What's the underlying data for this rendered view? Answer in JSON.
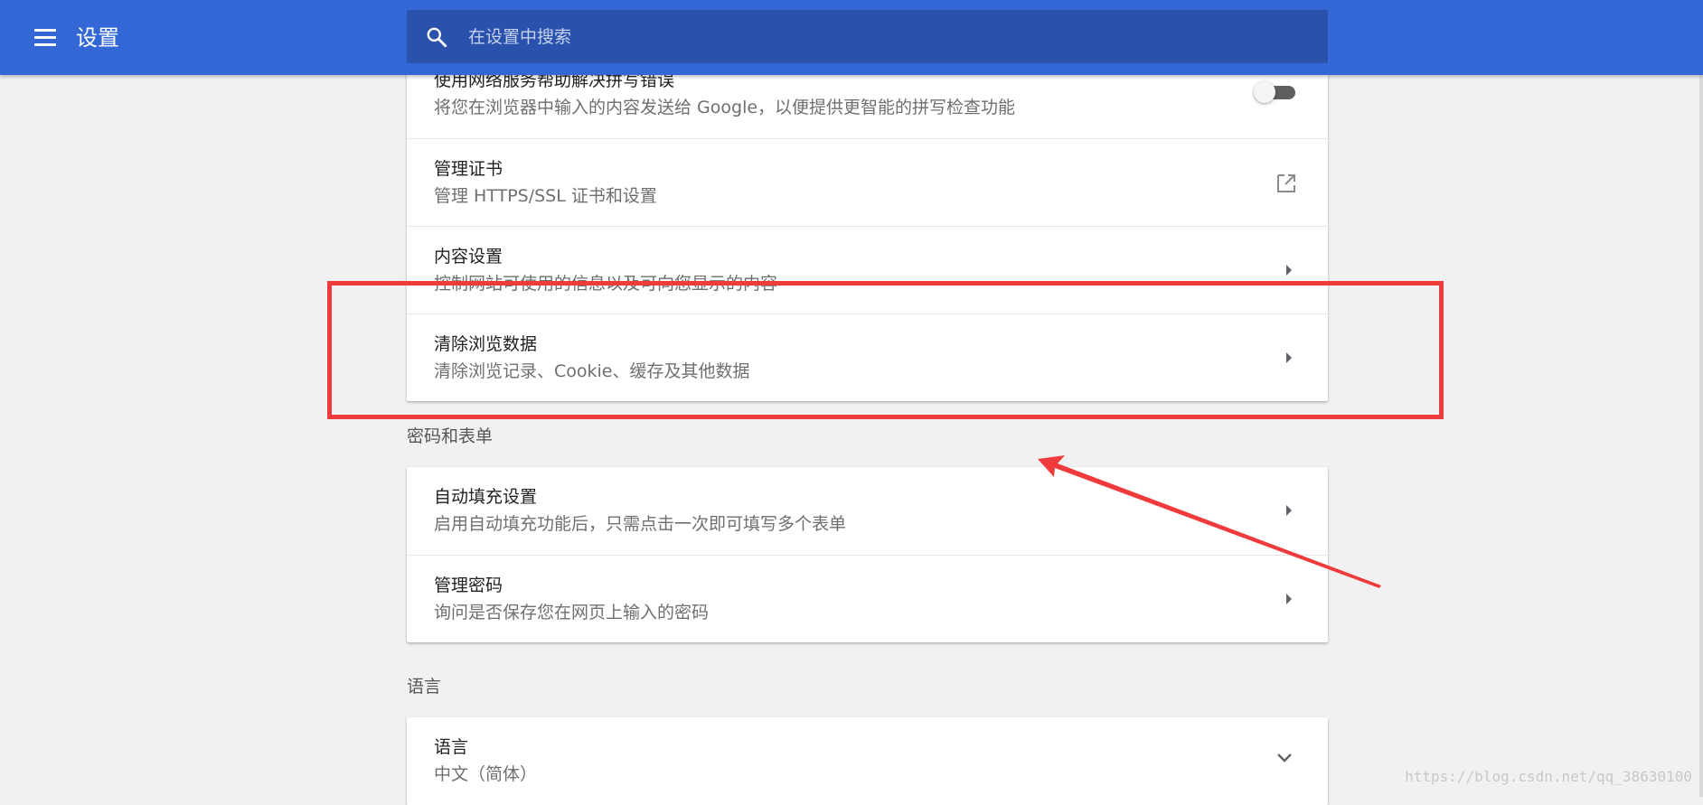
{
  "header": {
    "menu_icon": "hamburger-menu-icon",
    "title": "设置",
    "search": {
      "icon": "search-icon",
      "placeholder": "在设置中搜索",
      "value": ""
    }
  },
  "cards": {
    "privacy": {
      "rows": [
        {
          "title": "使用网络服务帮助解决拼写错误",
          "subtitle": "将您在浏览器中输入的内容发送给 Google，以便提供更智能的拼写检查功能",
          "control": "toggle",
          "toggle_on": false
        },
        {
          "title": "管理证书",
          "subtitle": "管理 HTTPS/SSL 证书和设置",
          "control": "external-link-icon"
        },
        {
          "title": "内容设置",
          "subtitle": "控制网站可使用的信息以及可向您显示的内容",
          "control": "chevron-right-icon"
        },
        {
          "title": "清除浏览数据",
          "subtitle": "清除浏览记录、Cookie、缓存及其他数据",
          "control": "chevron-right-icon"
        }
      ]
    },
    "passwords": {
      "section_label": "密码和表单",
      "rows": [
        {
          "title": "自动填充设置",
          "subtitle": "启用自动填充功能后，只需点击一次即可填写多个表单",
          "control": "chevron-right-icon"
        },
        {
          "title": "管理密码",
          "subtitle": "询问是否保存您在网页上输入的密码",
          "control": "chevron-right-icon"
        }
      ]
    },
    "languages": {
      "section_label": "语言",
      "rows": [
        {
          "title": "语言",
          "subtitle": "中文（简体）",
          "control": "chevron-down-icon"
        }
      ]
    }
  },
  "annotation": {
    "highlight_color": "#ef3b3b",
    "arrow_color": "#ef3b3b"
  },
  "watermark": "https://blog.csdn.net/qq_38630100",
  "colors": {
    "header_bg": "#3367d6",
    "search_bg": "#2a51ab",
    "page_bg": "#f1f1f1"
  }
}
